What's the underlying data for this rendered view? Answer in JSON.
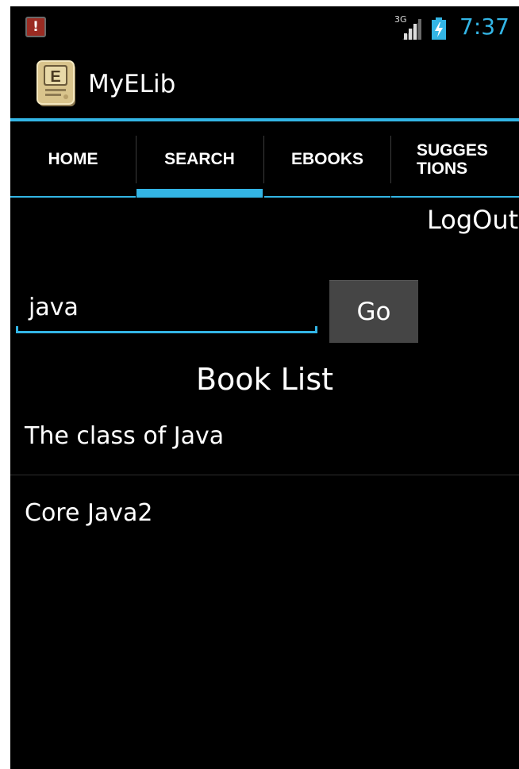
{
  "status_bar": {
    "notification_icon": "alert-icon",
    "network_type": "3G",
    "clock": "7:37",
    "accent": "#33b5e5"
  },
  "action_bar": {
    "app_icon": "ebook-app-icon",
    "title": "MyELib"
  },
  "tabs": [
    {
      "label": "HOME",
      "active": false
    },
    {
      "label": "SEARCH",
      "active": true
    },
    {
      "label": "EBOOKS",
      "active": false
    },
    {
      "label": "SUGGESTIONS",
      "active": false
    }
  ],
  "main": {
    "logout_label": "LogOut",
    "search": {
      "value": "java"
    },
    "go_label": "Go",
    "book_list_title": "Book List",
    "books": [
      "The class of Java",
      "Core Java2"
    ]
  }
}
